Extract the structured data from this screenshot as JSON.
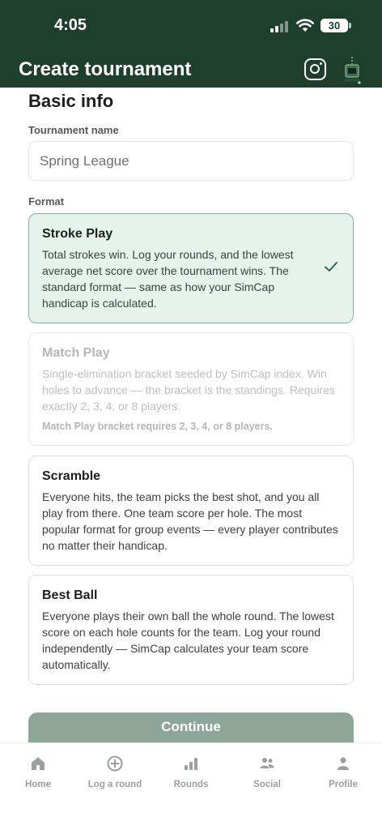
{
  "status_bar": {
    "time": "4:05",
    "battery": "30"
  },
  "header": {
    "title": "Create tournament",
    "icons": [
      "instagram-icon",
      "device-icon"
    ]
  },
  "basic_info": {
    "title": "Basic info",
    "name_label": "Tournament name",
    "name_value": "Spring League",
    "format_label": "Format"
  },
  "formats": [
    {
      "title": "Stroke Play",
      "description": "Total strokes win. Log your rounds, and the lowest average net score over the tournament wins. The standard format — same as how your SimCap handicap is calculated.",
      "state": "selected"
    },
    {
      "title": "Match Play",
      "description": "Single-elimination bracket seeded by SimCap index. Win holes to advance — the bracket is the standings. Requires exactly 2, 3, 4, or 8 players.",
      "note": "Match Play bracket requires 2, 3, 4, or 8 players.",
      "state": "disabled"
    },
    {
      "title": "Scramble",
      "description": "Everyone hits, the team picks the best shot, and you all play from there. One team score per hole. The most popular format for group events — every player contributes no matter their handicap.",
      "state": "default"
    },
    {
      "title": "Best Ball",
      "description": "Everyone plays their own ball the whole round. The lowest score on each hole counts for the team. Log your round independently — SimCap calculates your team score automatically.",
      "state": "default"
    }
  ],
  "continue_label": "Continue",
  "tabs": [
    {
      "label": "Home",
      "icon": "home-icon"
    },
    {
      "label": "Log a round",
      "icon": "plus-circle-icon"
    },
    {
      "label": "Rounds",
      "icon": "bar-chart-icon"
    },
    {
      "label": "Social",
      "icon": "people-icon"
    },
    {
      "label": "Profile",
      "icon": "person-icon"
    }
  ],
  "colors": {
    "brand": "#1f3f2d",
    "accent": "#78b895",
    "selected_bg": "#e6f3ec",
    "button": "#8ea697",
    "tab_inactive": "#9aa09c"
  }
}
